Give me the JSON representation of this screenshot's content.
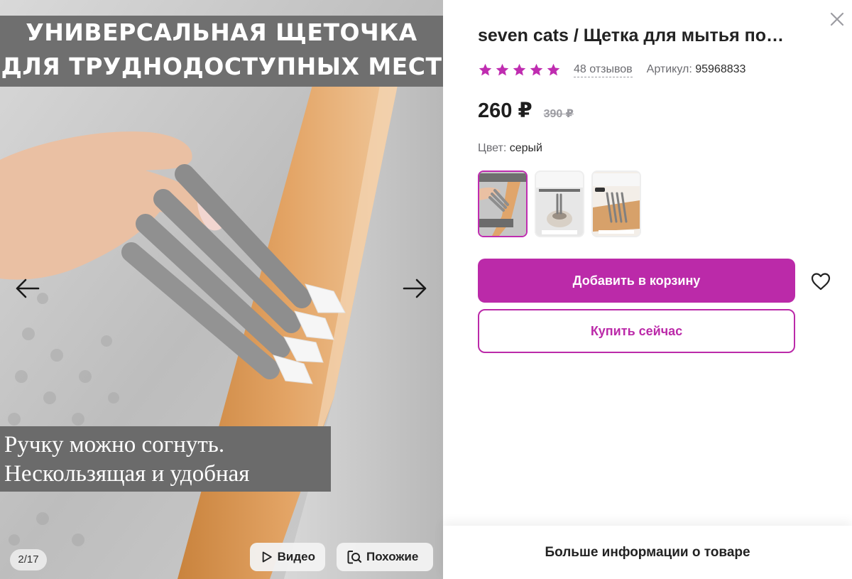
{
  "gallery": {
    "banner_top_line1": "УНИВЕРСАЛЬНАЯ ЩЕТОЧКА",
    "banner_top_line2": "ДЛЯ ТРУДНОДОСТУПНЫХ МЕСТ",
    "banner_bottom_line1": "Ручку можно согнуть.",
    "banner_bottom_line2": "Нескользящая и удобная",
    "counter": "2/17",
    "video_label": "Видео",
    "similar_label": "Похожие"
  },
  "product": {
    "title": "seven cats / Щетка для мытья по…",
    "rating": 5,
    "reviews": "48 отзывов",
    "sku_label": "Артикул:",
    "sku_value": "95968833",
    "price": "260 ₽",
    "old_price": "390 ₽",
    "color_label": "Цвет:",
    "color_value": "серый",
    "thumbs": [
      {
        "caption_top": "УНИВЕРСАЛЬНАЯ ЩЕТОЧКА ДЛЯ ТРУДНОДОСТУПНЫХ МЕСТ",
        "active": true
      },
      {
        "caption_top": "УНИВЕРСАЛЬНАЯ ЩЕТКА",
        "caption_bottom": "Сгибаемая ручка",
        "active": false
      },
      {
        "caption_top": "УНИВЕРСАЛЬНАЯ ЩЕТКА ДЛЯ КУХНИ",
        "badge": "2 шт.",
        "active": false
      }
    ],
    "add_to_cart": "Добавить в корзину",
    "buy_now": "Купить сейчас",
    "more_info": "Больше информации о товаре"
  },
  "colors": {
    "accent": "#bb2aa9",
    "star": "#bf2cb0"
  }
}
